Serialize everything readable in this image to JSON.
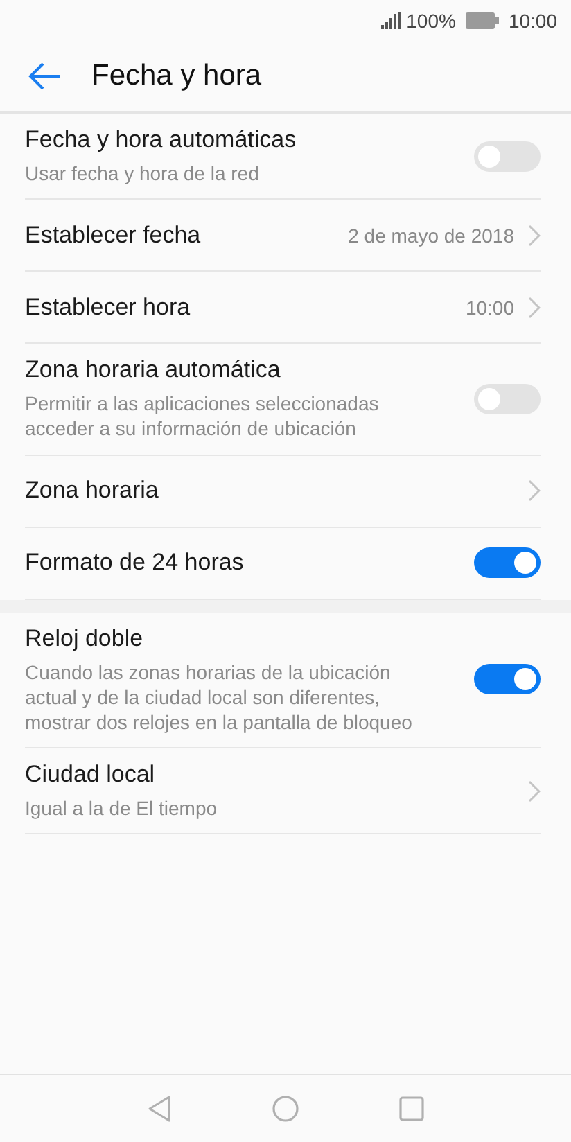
{
  "status_bar": {
    "battery": "100%",
    "time": "10:00"
  },
  "header": {
    "title": "Fecha y hora"
  },
  "sections": [
    {
      "items": [
        {
          "kind": "toggle",
          "title": "Fecha y hora automáticas",
          "subtitle": "Usar fecha y hora de la red",
          "on": false
        },
        {
          "kind": "link",
          "title": "Establecer fecha",
          "value": "2 de mayo de 2018"
        },
        {
          "kind": "link",
          "title": "Establecer hora",
          "value": "10:00"
        },
        {
          "kind": "toggle",
          "title": "Zona horaria automática",
          "subtitle": "Permitir a las aplicaciones seleccionadas acceder a su información de ubicación",
          "on": false
        },
        {
          "kind": "link",
          "title": "Zona horaria"
        },
        {
          "kind": "toggle",
          "title": "Formato de 24 horas",
          "on": true
        }
      ]
    },
    {
      "items": [
        {
          "kind": "toggle",
          "title": "Reloj doble",
          "subtitle": "Cuando las zonas horarias de la ubicación actual y de la ciudad local son diferentes, mostrar dos relojes en la pantalla de bloqueo",
          "on": true
        },
        {
          "kind": "link",
          "title": "Ciudad local",
          "subtitle": "Igual a la de El tiempo"
        }
      ]
    }
  ]
}
